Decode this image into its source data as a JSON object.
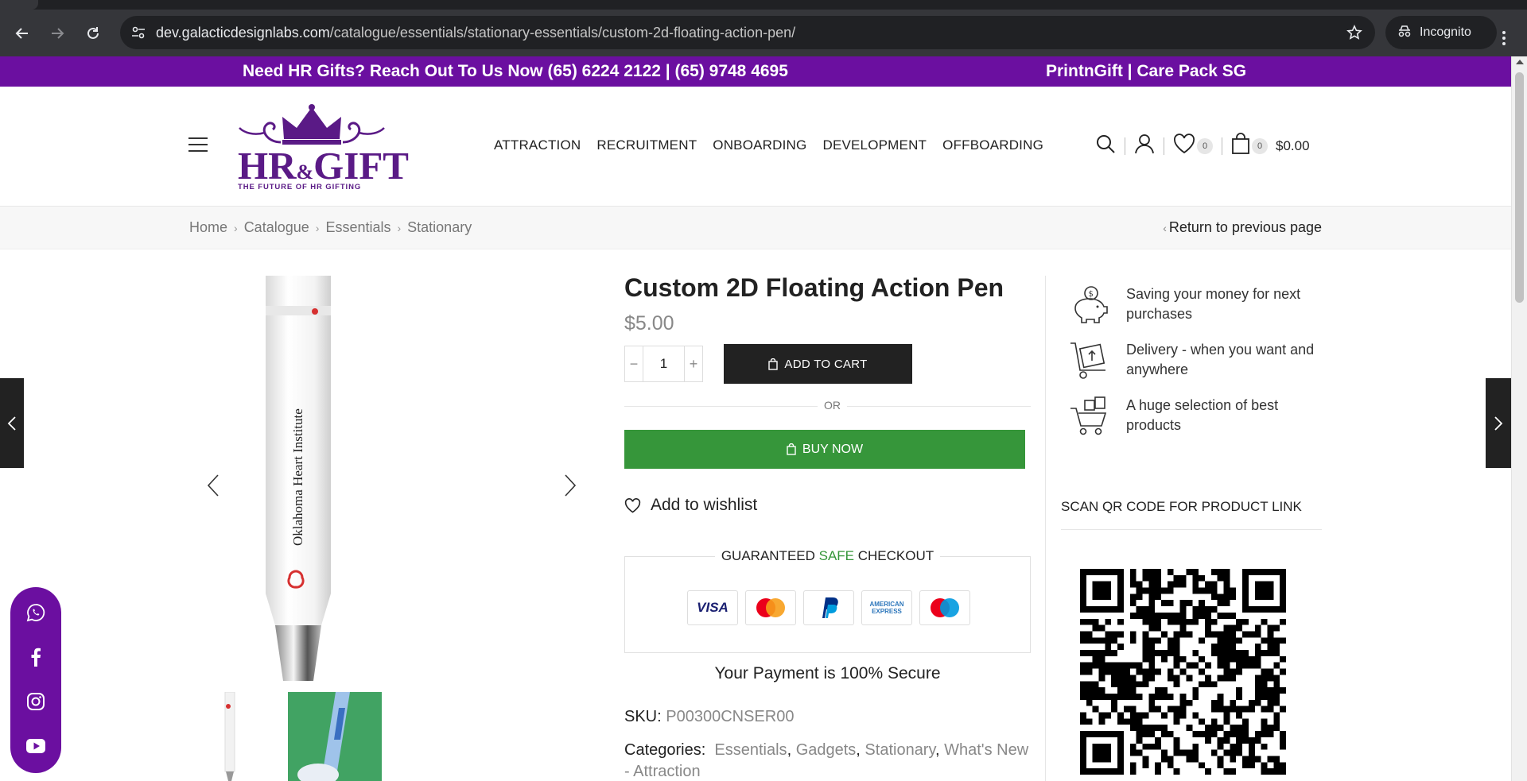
{
  "browser": {
    "url_host": "dev.galacticdesignlabs.com",
    "url_path": "/catalogue/essentials/stationary-essentials/custom-2d-floating-action-pen/",
    "profile_label": "Incognito"
  },
  "topbar": {
    "left_text": "Need HR Gifts? Reach Out To Us Now (65) 6224 2122 | (65) 9748 4695",
    "right_text": "PrintnGift | Care Pack SG"
  },
  "logo": {
    "word_hr": "HR",
    "word_amp": "&",
    "word_gift": "GIFT",
    "tagline": "THE FUTURE OF HR GIFTING"
  },
  "nav": [
    "ATTRACTION",
    "RECRUITMENT",
    "ONBOARDING",
    "DEVELOPMENT",
    "OFFBOARDING"
  ],
  "header": {
    "wishlist_count": "0",
    "cart_count": "0",
    "cart_total": "$0.00"
  },
  "breadcrumb": {
    "items": [
      "Home",
      "Catalogue",
      "Essentials",
      "Stationary"
    ],
    "return_label": "Return to previous page"
  },
  "product": {
    "title": "Custom 2D Floating Action Pen",
    "price": "$5.00",
    "quantity": "1",
    "pen_print": "Oklahoma Heart Institute",
    "add_to_cart_label": "ADD TO CART",
    "or_label": "OR",
    "buy_now_label": "BUY NOW",
    "wishlist_label": "Add to wishlist",
    "checkout_pre": "GUARANTEED ",
    "checkout_safe": "SAFE",
    "checkout_post": " CHECKOUT",
    "payment_cards": [
      "VISA",
      "Mastercard",
      "PayPal",
      "AMERICAN EXPRESS",
      "Maestro"
    ],
    "secure_text": "Your Payment is 100% Secure",
    "sku_label": "SKU:",
    "sku_value": "P00300CNSER00",
    "categories_label": "Categories:",
    "categories": [
      "Essentials",
      "Gadgets",
      "Stationary",
      "What's New - Attraction"
    ]
  },
  "features": [
    {
      "icon": "piggy-bank-icon",
      "text": "Saving your money for next purchases"
    },
    {
      "icon": "delivery-box-icon",
      "text": "Delivery - when you want and anywhere"
    },
    {
      "icon": "gift-cart-icon",
      "text": "A huge selection of best products"
    }
  ],
  "qr": {
    "title": "SCAN QR CODE FOR PRODUCT LINK"
  },
  "social": [
    "whatsapp-icon",
    "facebook-icon",
    "instagram-icon",
    "youtube-icon"
  ],
  "colors": {
    "brand_purple": "#6b0fa0",
    "buy_green": "#36963a",
    "dark_button": "#222222"
  }
}
